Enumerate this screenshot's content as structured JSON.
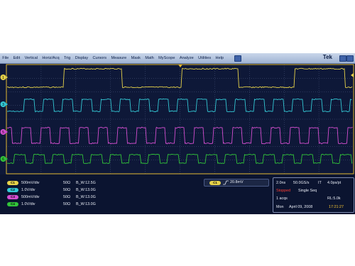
{
  "menu": [
    "File",
    "Edit",
    "Vertical",
    "Horiz/Acq",
    "Trig",
    "Display",
    "Cursors",
    "Measure",
    "Mask",
    "Math",
    "MyScope",
    "Analyze",
    "Utilities",
    "Help"
  ],
  "brand": "Tek",
  "channel_markers": [
    "1",
    "3",
    "5",
    "6"
  ],
  "channels": [
    {
      "badge": "C1",
      "color": "#e6d24a",
      "scale": "500mV/div",
      "impedance": "50Ω",
      "bw": "12.5G"
    },
    {
      "badge": "C2",
      "color": "#34c9d6",
      "scale": "1.0V/div",
      "impedance": "50Ω",
      "bw": "13.0G"
    },
    {
      "badge": "C3",
      "color": "#d54fd1",
      "scale": "500mV/div",
      "impedance": "50Ω",
      "bw": "13.0G"
    },
    {
      "badge": "C4",
      "color": "#32c53a",
      "scale": "1.0V/div",
      "impedance": "50Ω",
      "bw": "13.0G"
    }
  ],
  "bw_symbol": "B_W",
  "trigger": {
    "badge": "C1",
    "slope_icon": "rising-edge-icon",
    "level": "20.8mV"
  },
  "acquisition": {
    "horizontal_scale": "2.0ns",
    "sample_rate": "50.0GS/s",
    "mode": "IT",
    "resolution": "4.0ps/pt",
    "state": "Stopped",
    "sequence": "Single Seq",
    "acqs": "1 acqs",
    "record": "RL:5.0k",
    "day": "Mon",
    "date": "April 09, 2008",
    "time": "17:21:27"
  },
  "state_color": "#ff3b30",
  "time_color": "#f3c232"
}
